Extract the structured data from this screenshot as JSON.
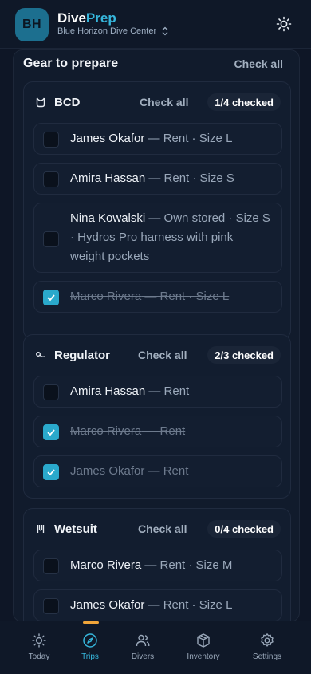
{
  "app": {
    "avatar_initials": "BH",
    "brand_part1": "Dive",
    "brand_part2": "Prep",
    "dive_center": "Blue Horizon Dive Center"
  },
  "section": {
    "title": "Gear to prepare",
    "check_all": "Check all"
  },
  "groups": [
    {
      "title": "BCD",
      "icon": "bcd-vest-icon",
      "check_all": "Check all",
      "badge": "1/4 checked",
      "items": [
        {
          "name": "James Okafor",
          "meta": " — Rent · Size L",
          "checked": false
        },
        {
          "name": "Amira Hassan",
          "meta": " — Rent · Size S",
          "checked": false
        },
        {
          "name": "Nina Kowalski",
          "meta": " — Own stored · Size S · Hydros Pro harness with pink weight pockets",
          "checked": false
        },
        {
          "name": "Marco Rivera",
          "meta": " — Rent · Size L",
          "checked": true
        }
      ]
    },
    {
      "title": "Regulator",
      "icon": "regulator-icon",
      "check_all": "Check all",
      "badge": "2/3 checked",
      "items": [
        {
          "name": "Amira Hassan",
          "meta": " — Rent",
          "checked": false
        },
        {
          "name": "Marco Rivera",
          "meta": " — Rent",
          "checked": true
        },
        {
          "name": "James Okafor",
          "meta": " — Rent",
          "checked": true
        }
      ]
    },
    {
      "title": "Wetsuit",
      "icon": "wetsuit-icon",
      "check_all": "Check all",
      "badge": "0/4 checked",
      "items": [
        {
          "name": "Marco Rivera",
          "meta": " — Rent · Size M",
          "checked": false
        },
        {
          "name": "James Okafor",
          "meta": " — Rent · Size L",
          "checked": false
        }
      ]
    }
  ],
  "nav": [
    {
      "label": "Today",
      "icon": "sun-icon",
      "active": false
    },
    {
      "label": "Trips",
      "icon": "compass-icon",
      "active": true
    },
    {
      "label": "Divers",
      "icon": "people-icon",
      "active": false
    },
    {
      "label": "Inventory",
      "icon": "box-icon",
      "active": false
    },
    {
      "label": "Settings",
      "icon": "gear-icon",
      "active": false
    }
  ],
  "colors": {
    "accent": "#36b6dc",
    "checkbox_on": "#2aa9cc",
    "nav_indicator": "#f0a53a",
    "background": "#0e1626"
  }
}
